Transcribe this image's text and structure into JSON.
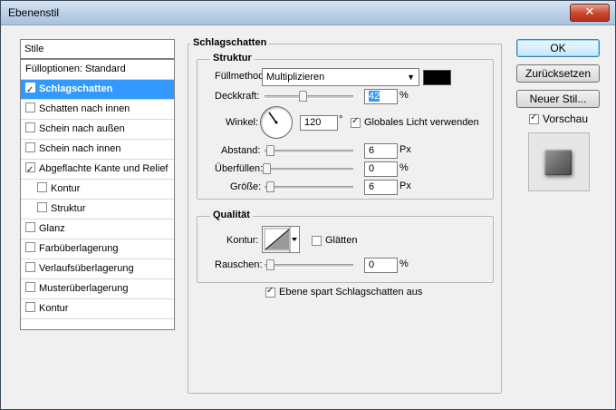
{
  "window": {
    "title": "Ebenenstil"
  },
  "stylelist": {
    "header": "Stile",
    "blend_options": "Fülloptionen: Standard",
    "items": [
      {
        "label": "Schlagschatten",
        "checked": true,
        "selected": true,
        "indent": false
      },
      {
        "label": "Schatten nach innen",
        "checked": false,
        "selected": false,
        "indent": false
      },
      {
        "label": "Schein nach außen",
        "checked": false,
        "selected": false,
        "indent": false
      },
      {
        "label": "Schein nach innen",
        "checked": false,
        "selected": false,
        "indent": false
      },
      {
        "label": "Abgeflachte Kante und Relief",
        "checked": true,
        "selected": false,
        "indent": false
      },
      {
        "label": "Kontur",
        "checked": false,
        "selected": false,
        "indent": true
      },
      {
        "label": "Struktur",
        "checked": false,
        "selected": false,
        "indent": true
      },
      {
        "label": "Glanz",
        "checked": false,
        "selected": false,
        "indent": false
      },
      {
        "label": "Farbüberlagerung",
        "checked": false,
        "selected": false,
        "indent": false
      },
      {
        "label": "Verlaufsüberlagerung",
        "checked": false,
        "selected": false,
        "indent": false
      },
      {
        "label": "Musterüberlagerung",
        "checked": false,
        "selected": false,
        "indent": false
      },
      {
        "label": "Kontur",
        "checked": false,
        "selected": false,
        "indent": false
      }
    ]
  },
  "panel": {
    "title": "Schlagschatten",
    "structure": {
      "title": "Struktur",
      "blend_mode_label": "Füllmethode:",
      "blend_mode_value": "Multiplizieren",
      "shadow_color": "#000000",
      "opacity_label": "Deckkraft:",
      "opacity_value": "42",
      "opacity_unit": "%",
      "opacity_level": 0.42,
      "angle_label": "Winkel:",
      "angle_value": "120",
      "angle_unit": "°",
      "global_light_label": "Globales Licht verwenden",
      "global_light_checked": true,
      "distance_label": "Abstand:",
      "distance_value": "6",
      "distance_unit": "Px",
      "spread_label": "Überfüllen:",
      "spread_value": "0",
      "spread_unit": "%",
      "size_label": "Größe:",
      "size_value": "6",
      "size_unit": "Px"
    },
    "quality": {
      "title": "Qualität",
      "contour_label": "Kontur:",
      "antialias_label": "Glätten",
      "antialias_checked": false,
      "noise_label": "Rauschen:",
      "noise_value": "0",
      "noise_unit": "%"
    },
    "knockout_label": "Ebene spart Schlagschatten aus",
    "knockout_checked": true
  },
  "buttons": {
    "ok": "OK",
    "reset": "Zurücksetzen",
    "new_style": "Neuer Stil...",
    "preview_label": "Vorschau",
    "preview_checked": true
  }
}
